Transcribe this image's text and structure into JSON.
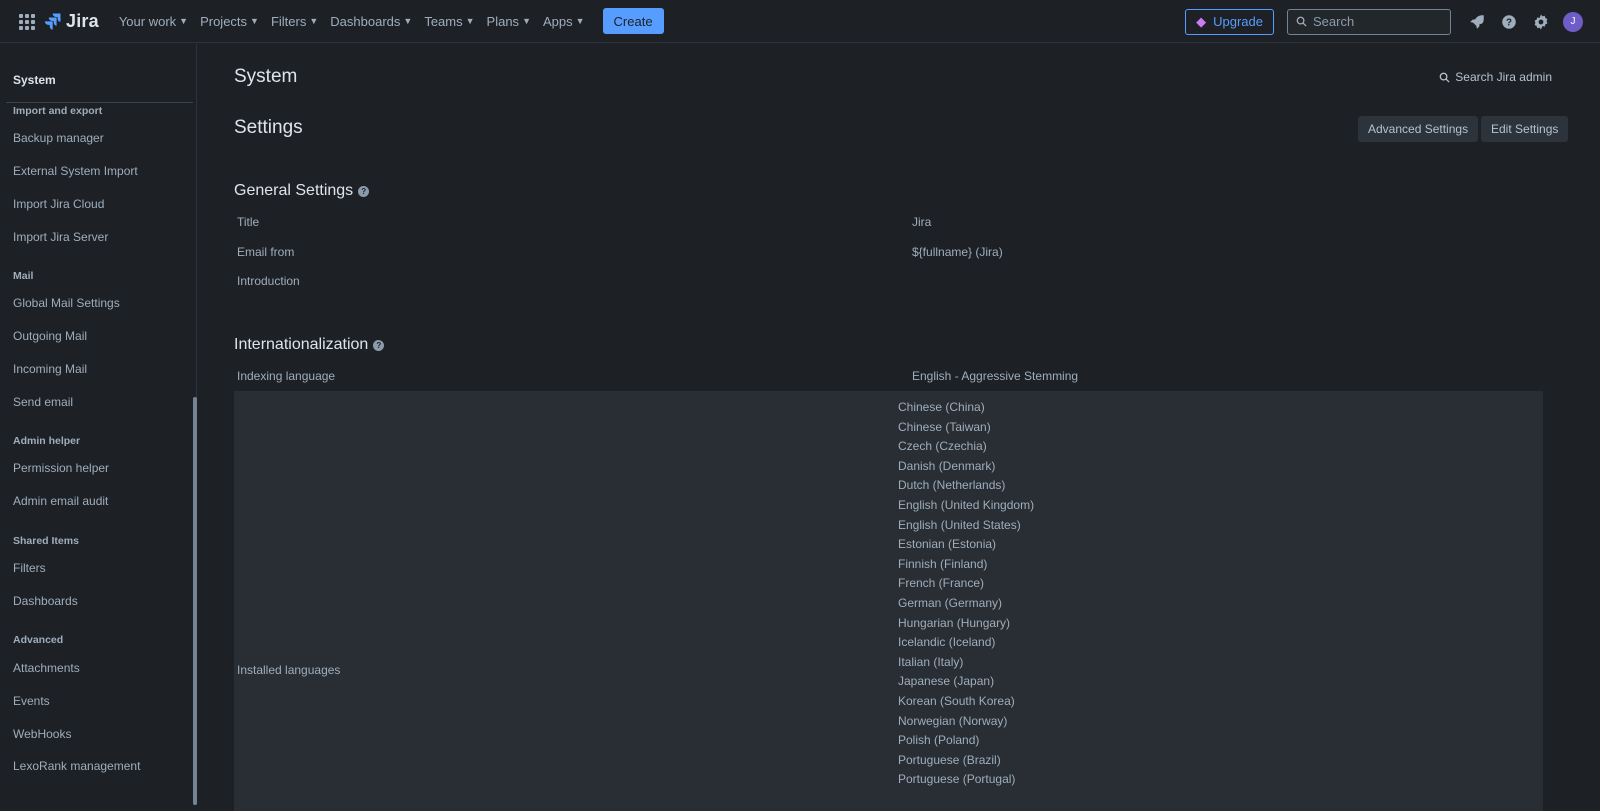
{
  "topnav": {
    "logo_text": "Jira",
    "items": [
      {
        "label": "Your work"
      },
      {
        "label": "Projects"
      },
      {
        "label": "Filters"
      },
      {
        "label": "Dashboards"
      },
      {
        "label": "Teams"
      },
      {
        "label": "Plans"
      },
      {
        "label": "Apps"
      }
    ],
    "create_label": "Create",
    "upgrade_label": "Upgrade",
    "search_placeholder": "Search",
    "avatar_initial": "J",
    "accent_color": "#579dff"
  },
  "sidebar": {
    "title": "System",
    "groups": [
      {
        "heading": "Import and export",
        "items": [
          "Backup manager",
          "External System Import",
          "Import Jira Cloud",
          "Import Jira Server"
        ]
      },
      {
        "heading": "Mail",
        "items": [
          "Global Mail Settings",
          "Outgoing Mail",
          "Incoming Mail",
          "Send email"
        ]
      },
      {
        "heading": "Admin helper",
        "items": [
          "Permission helper",
          "Admin email audit"
        ]
      },
      {
        "heading": "Shared Items",
        "items": [
          "Filters",
          "Dashboards"
        ]
      },
      {
        "heading": "Advanced",
        "items": [
          "Attachments",
          "Events",
          "WebHooks",
          "LexoRank management"
        ]
      }
    ]
  },
  "main": {
    "page_title": "System",
    "search_admin_label": "Search Jira admin",
    "settings_title": "Settings",
    "advanced_settings_label": "Advanced Settings",
    "edit_settings_label": "Edit Settings",
    "general": {
      "heading": "General Settings",
      "rows": [
        {
          "label": "Title",
          "value": "Jira"
        },
        {
          "label": "Email from",
          "value": "${fullname} (Jira)"
        },
        {
          "label": "Introduction",
          "value": ""
        }
      ]
    },
    "i18n": {
      "heading": "Internationalization",
      "indexing_label": "Indexing language",
      "indexing_value": "English - Aggressive Stemming",
      "installed_label": "Installed languages",
      "installed_languages": [
        "Chinese (China)",
        "Chinese (Taiwan)",
        "Czech (Czechia)",
        "Danish (Denmark)",
        "Dutch (Netherlands)",
        "English (United Kingdom)",
        "English (United States)",
        "Estonian (Estonia)",
        "Finnish (Finland)",
        "French (France)",
        "German (Germany)",
        "Hungarian (Hungary)",
        "Icelandic (Iceland)",
        "Italian (Italy)",
        "Japanese (Japan)",
        "Korean (South Korea)",
        "Norwegian (Norway)",
        "Polish (Poland)",
        "Portuguese (Brazil)",
        "Portuguese (Portugal)"
      ]
    }
  }
}
